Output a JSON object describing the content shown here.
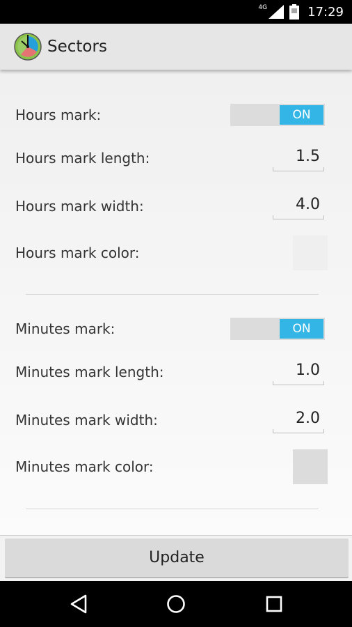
{
  "status_bar": {
    "network_label": "4G",
    "time": "17:29",
    "icons": [
      "signal-icon",
      "battery-icon"
    ]
  },
  "action_bar": {
    "title": "Sectors",
    "icon": "sectors-app-icon"
  },
  "settings": {
    "hours_mark_label": "Hours mark:",
    "hours_mark_toggle": "ON",
    "hours_mark_length_label": "Hours mark length:",
    "hours_mark_length_value": "1.5",
    "hours_mark_width_label": "Hours mark width:",
    "hours_mark_width_value": "4.0",
    "hours_mark_color_label": "Hours mark color:",
    "hours_mark_color": "#efefef",
    "minutes_mark_label": "Minutes mark:",
    "minutes_mark_toggle": "ON",
    "minutes_mark_length_label": "Minutes mark length:",
    "minutes_mark_length_value": "1.0",
    "minutes_mark_width_label": "Minutes mark width:",
    "minutes_mark_width_value": "2.0",
    "minutes_mark_color_label": "Minutes mark color:",
    "minutes_mark_color": "#dcdcdc"
  },
  "update_button": "Update",
  "nav_bar": {
    "icons": [
      "back-icon",
      "home-icon",
      "recents-icon"
    ]
  },
  "colors": {
    "toggle_on": "#33b5e5",
    "action_bar": "#e6e6e6",
    "button": "#dadada"
  }
}
